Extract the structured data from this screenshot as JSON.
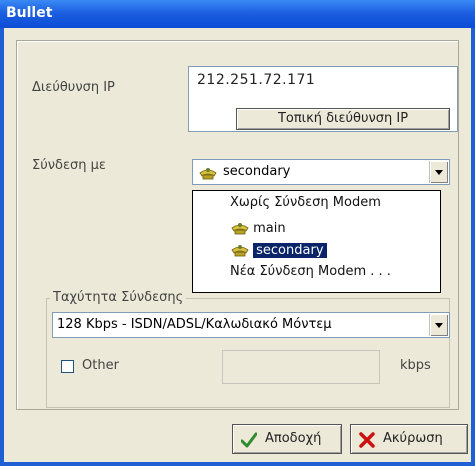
{
  "window": {
    "title": "Bullet"
  },
  "ip": {
    "label": "Διεύθυνση IP",
    "value": "212.251.72.171",
    "local_button": "Τοπική διεύθυνση IP"
  },
  "connection": {
    "label": "Σύνδεση με",
    "selected": "secondary",
    "options": [
      {
        "label": "Χωρίς Σύνδεση Modem",
        "icon": "none"
      },
      {
        "label": "main",
        "icon": "phone-icon"
      },
      {
        "label": "secondary",
        "icon": "phone-icon",
        "highlighted": true
      },
      {
        "label": "Νέα Σύνδεση Modem . . .",
        "icon": "none"
      }
    ]
  },
  "speed": {
    "group_label": "Ταχύτητα Σύνδεσης",
    "selected": "128 Kbps - ISDN/ADSL/Καλωδιακό Μόντεμ",
    "other_label": "Other",
    "other_checked": false,
    "other_value": "",
    "unit": "kbps"
  },
  "buttons": {
    "ok": "Αποδοχή",
    "cancel": "Ακύρωση"
  },
  "colors": {
    "titlebar": "#1c5fe0",
    "highlight": "#0a246a",
    "ok_icon": "#2e8b2e",
    "cancel_icon": "#cc1111"
  }
}
